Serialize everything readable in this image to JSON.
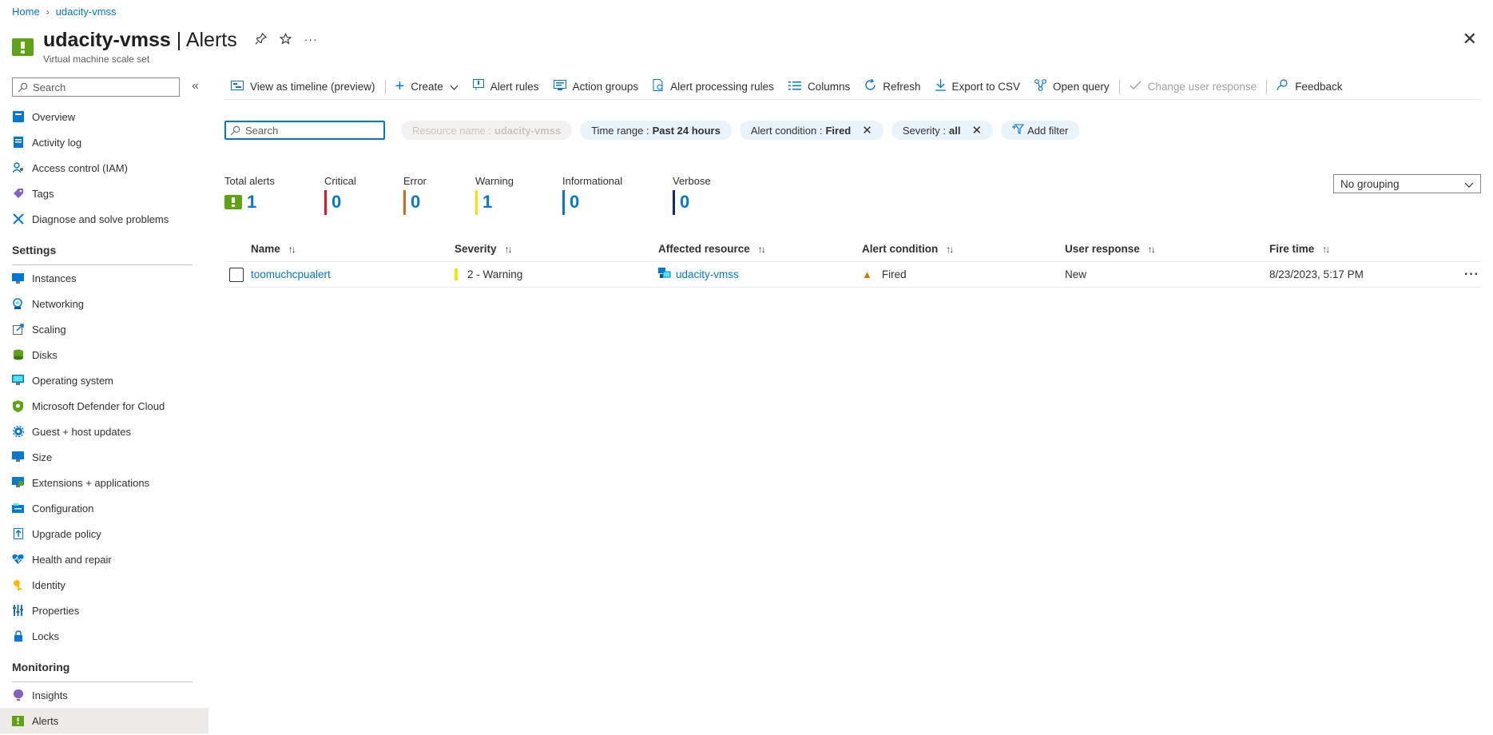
{
  "breadcrumb": {
    "home": "Home",
    "resource": "udacity-vmss"
  },
  "header": {
    "resource_name": "udacity-vmss",
    "page_name": "Alerts",
    "separator": " | ",
    "subtitle": "Virtual machine scale set",
    "close": "✕"
  },
  "sidebar": {
    "search_placeholder": "Search",
    "collapse": "«",
    "top_items": [
      {
        "label": "Overview",
        "icon": "overview-icon"
      },
      {
        "label": "Activity log",
        "icon": "activity-log-icon"
      },
      {
        "label": "Access control (IAM)",
        "icon": "iam-icon"
      },
      {
        "label": "Tags",
        "icon": "tag-icon"
      },
      {
        "label": "Diagnose and solve problems",
        "icon": "wrench-icon"
      }
    ],
    "settings_title": "Settings",
    "settings_items": [
      {
        "label": "Instances",
        "icon": "instances-icon"
      },
      {
        "label": "Networking",
        "icon": "networking-icon"
      },
      {
        "label": "Scaling",
        "icon": "scaling-icon"
      },
      {
        "label": "Disks",
        "icon": "disks-icon"
      },
      {
        "label": "Operating system",
        "icon": "os-icon"
      },
      {
        "label": "Microsoft Defender for Cloud",
        "icon": "shield-icon"
      },
      {
        "label": "Guest + host updates",
        "icon": "gear-icon"
      },
      {
        "label": "Size",
        "icon": "size-icon"
      },
      {
        "label": "Extensions + applications",
        "icon": "extensions-icon"
      },
      {
        "label": "Configuration",
        "icon": "configuration-icon"
      },
      {
        "label": "Upgrade policy",
        "icon": "upgrade-icon"
      },
      {
        "label": "Health and repair",
        "icon": "health-icon"
      },
      {
        "label": "Identity",
        "icon": "identity-icon"
      },
      {
        "label": "Properties",
        "icon": "properties-icon"
      },
      {
        "label": "Locks",
        "icon": "lock-icon"
      }
    ],
    "monitoring_title": "Monitoring",
    "monitoring_items": [
      {
        "label": "Insights",
        "icon": "insights-icon"
      },
      {
        "label": "Alerts",
        "icon": "alerts-icon",
        "active": true
      }
    ]
  },
  "toolbar": {
    "timeline": "View as timeline (preview)",
    "create": "Create",
    "alert_rules": "Alert rules",
    "action_groups": "Action groups",
    "processing_rules": "Alert processing rules",
    "columns": "Columns",
    "refresh": "Refresh",
    "export": "Export to CSV",
    "open_query": "Open query",
    "change_response": "Change user response",
    "feedback": "Feedback"
  },
  "filters": {
    "search_placeholder": "Search",
    "resource_name_label": "Resource name : ",
    "resource_name_value": "udacity-vmss",
    "time_range_label": "Time range : ",
    "time_range_value": "Past 24 hours",
    "condition_label": "Alert condition : ",
    "condition_value": "Fired",
    "severity_label": "Severity : ",
    "severity_value": "all",
    "add_filter": "Add filter"
  },
  "summary": {
    "total_label": "Total alerts",
    "total": "1",
    "critical_label": "Critical",
    "critical": "0",
    "error_label": "Error",
    "error": "0",
    "warning_label": "Warning",
    "warning": "1",
    "informational_label": "Informational",
    "informational": "0",
    "verbose_label": "Verbose",
    "verbose": "0",
    "colors": {
      "critical": "#e81123",
      "error": "#da6b1d",
      "warning": "#fce100",
      "informational": "#0078d4",
      "verbose": "#1a237e"
    }
  },
  "grouping": {
    "value": "No grouping"
  },
  "table": {
    "headers": {
      "name": "Name",
      "severity": "Severity",
      "resource": "Affected resource",
      "condition": "Alert condition",
      "response": "User response",
      "fire_time": "Fire time"
    },
    "rows": [
      {
        "name": "toomuchcpualert",
        "severity": "2 - Warning",
        "resource": "udacity-vmss",
        "condition": "Fired",
        "response": "New",
        "fire_time": "8/23/2023, 5:17 PM"
      }
    ]
  }
}
